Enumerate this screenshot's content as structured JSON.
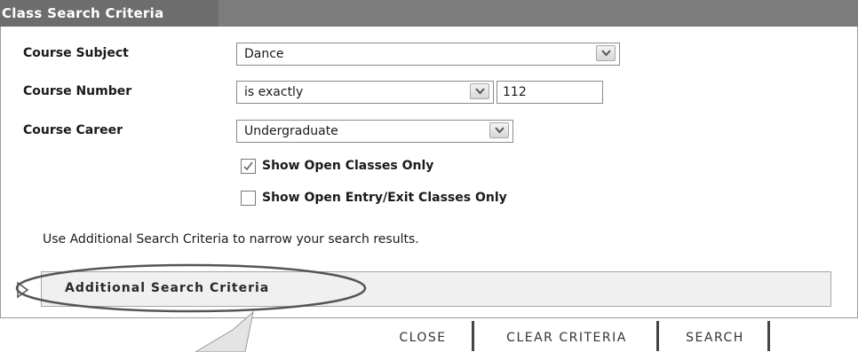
{
  "header": {
    "title": "Class Search Criteria"
  },
  "fields": {
    "subject": {
      "label": "Course Subject",
      "value": "Dance"
    },
    "number": {
      "label": "Course Number",
      "operator": "is exactly",
      "value": "112"
    },
    "career": {
      "label": "Course Career",
      "value": "Undergraduate"
    }
  },
  "checkboxes": {
    "open_only": {
      "label": "Show Open Classes Only",
      "checked": true
    },
    "open_entry": {
      "label": "Show Open Entry/Exit Classes Only",
      "checked": false
    }
  },
  "hint": "Use Additional Search Criteria to narrow your search results.",
  "additional": {
    "label": "Additional Search Criteria",
    "expanded": false
  },
  "buttons": {
    "close": "CLOSE",
    "clear": "CLEAR CRITERIA",
    "search": "SEARCH"
  },
  "colors": {
    "header_bg": "#6d6d6d",
    "bar_bg": "#f0f0f0"
  }
}
